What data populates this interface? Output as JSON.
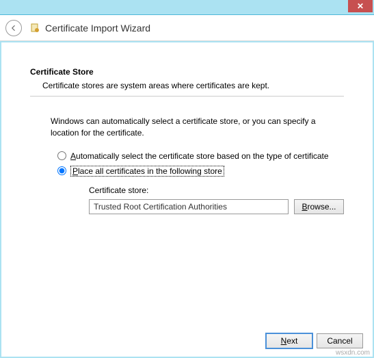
{
  "titlebar": {
    "close_glyph": "✕"
  },
  "header": {
    "title": "Certificate Import Wizard"
  },
  "page": {
    "section_title": "Certificate Store",
    "section_desc": "Certificate stores are system areas where certificates are kept.",
    "instruction": "Windows can automatically select a certificate store, or you can specify a location for the certificate.",
    "radio_auto_prefix": "A",
    "radio_auto_rest": "utomatically select the certificate store based on the type of certificate",
    "radio_place_prefix": "P",
    "radio_place_rest": "lace all certificates in the following store",
    "store_label": "Certificate store:",
    "store_value": "Trusted Root Certification Authorities",
    "browse_prefix": "B",
    "browse_rest": "rowse..."
  },
  "footer": {
    "next_prefix": "N",
    "next_rest": "ext",
    "cancel": "Cancel"
  },
  "watermark": "wsxdn.com"
}
